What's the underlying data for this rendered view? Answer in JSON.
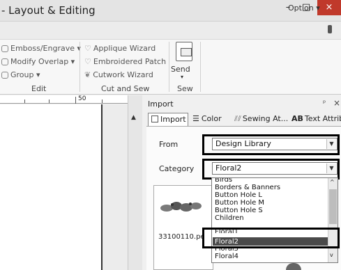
{
  "window": {
    "title": "- Layout & Editing",
    "minimize": "–",
    "maximize": "□",
    "close": "×"
  },
  "menubar": {
    "option": "Option",
    "dropdown_glyph": "▾"
  },
  "ribbon": {
    "edit_group": {
      "items": [
        "Emboss/Engrave ▾",
        "Modify Overlap ▾",
        "Group ▾"
      ],
      "label": "Edit"
    },
    "cut_sew_group": {
      "items": [
        "Applique Wizard",
        "Embroidered Patch",
        "Cutwork Wizard"
      ],
      "label": "Cut and Sew"
    },
    "sew_group": {
      "send_label": "Send",
      "send_arrow": "▾",
      "label": "Sew"
    }
  },
  "ruler": {
    "mark": "50"
  },
  "import_panel": {
    "title": "Import",
    "pin": "ᵖ",
    "close": "×",
    "tabs": [
      "Import",
      "Color",
      "Sewing At...",
      "Text Attrib..."
    ],
    "tab_ab_prefix": "AB",
    "from_label": "From",
    "from_value": "Design Library",
    "category_label": "Category",
    "category_value": "Floral2",
    "category_options": [
      "Birds",
      "Borders & Banners",
      "Button Hole L",
      "Button Hole M",
      "Button Hole S",
      "Children",
      "Floral1",
      "Floral2",
      "Floral3",
      "Floral4"
    ],
    "selected_option": "Floral2",
    "preview_filename": "33100110.pe"
  },
  "colors": {
    "selected_row": "#4a4a4a",
    "close_button": "#c0392b",
    "highlight_border": "#000000"
  }
}
